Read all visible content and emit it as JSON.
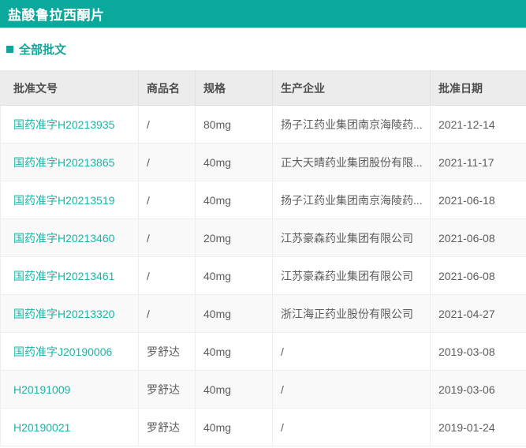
{
  "header": {
    "title": "盐酸鲁拉西酮片",
    "bg_color": "#0aa99b",
    "text_color": "#ffffff"
  },
  "section": {
    "label": "全部批文",
    "accent_color": "#10a597"
  },
  "table": {
    "columns": [
      "批准文号",
      "商品名",
      "规格",
      "生产企业",
      "批准日期"
    ],
    "link_color": "#1eb3a4",
    "rows": [
      {
        "approval_no": "国药准字H20213935",
        "trade_name": "/",
        "spec": "80mg",
        "manufacturer": "扬子江药业集团南京海陵药...",
        "approval_date": "2021-12-14"
      },
      {
        "approval_no": "国药准字H20213865",
        "trade_name": "/",
        "spec": "40mg",
        "manufacturer": "正大天晴药业集团股份有限...",
        "approval_date": "2021-11-17"
      },
      {
        "approval_no": "国药准字H20213519",
        "trade_name": "/",
        "spec": "40mg",
        "manufacturer": "扬子江药业集团南京海陵药...",
        "approval_date": "2021-06-18"
      },
      {
        "approval_no": "国药准字H20213460",
        "trade_name": "/",
        "spec": "20mg",
        "manufacturer": "江苏豪森药业集团有限公司",
        "approval_date": "2021-06-08"
      },
      {
        "approval_no": "国药准字H20213461",
        "trade_name": "/",
        "spec": "40mg",
        "manufacturer": "江苏豪森药业集团有限公司",
        "approval_date": "2021-06-08"
      },
      {
        "approval_no": "国药准字H20213320",
        "trade_name": "/",
        "spec": "40mg",
        "manufacturer": "浙江海正药业股份有限公司",
        "approval_date": "2021-04-27"
      },
      {
        "approval_no": "国药准字J20190006",
        "trade_name": "罗舒达",
        "spec": "40mg",
        "manufacturer": "/",
        "approval_date": "2019-03-08"
      },
      {
        "approval_no": "H20191009",
        "trade_name": "罗舒达",
        "spec": "40mg",
        "manufacturer": "/",
        "approval_date": "2019-03-06"
      },
      {
        "approval_no": "H20190021",
        "trade_name": "罗舒达",
        "spec": "40mg",
        "manufacturer": "/",
        "approval_date": "2019-01-24"
      }
    ]
  }
}
